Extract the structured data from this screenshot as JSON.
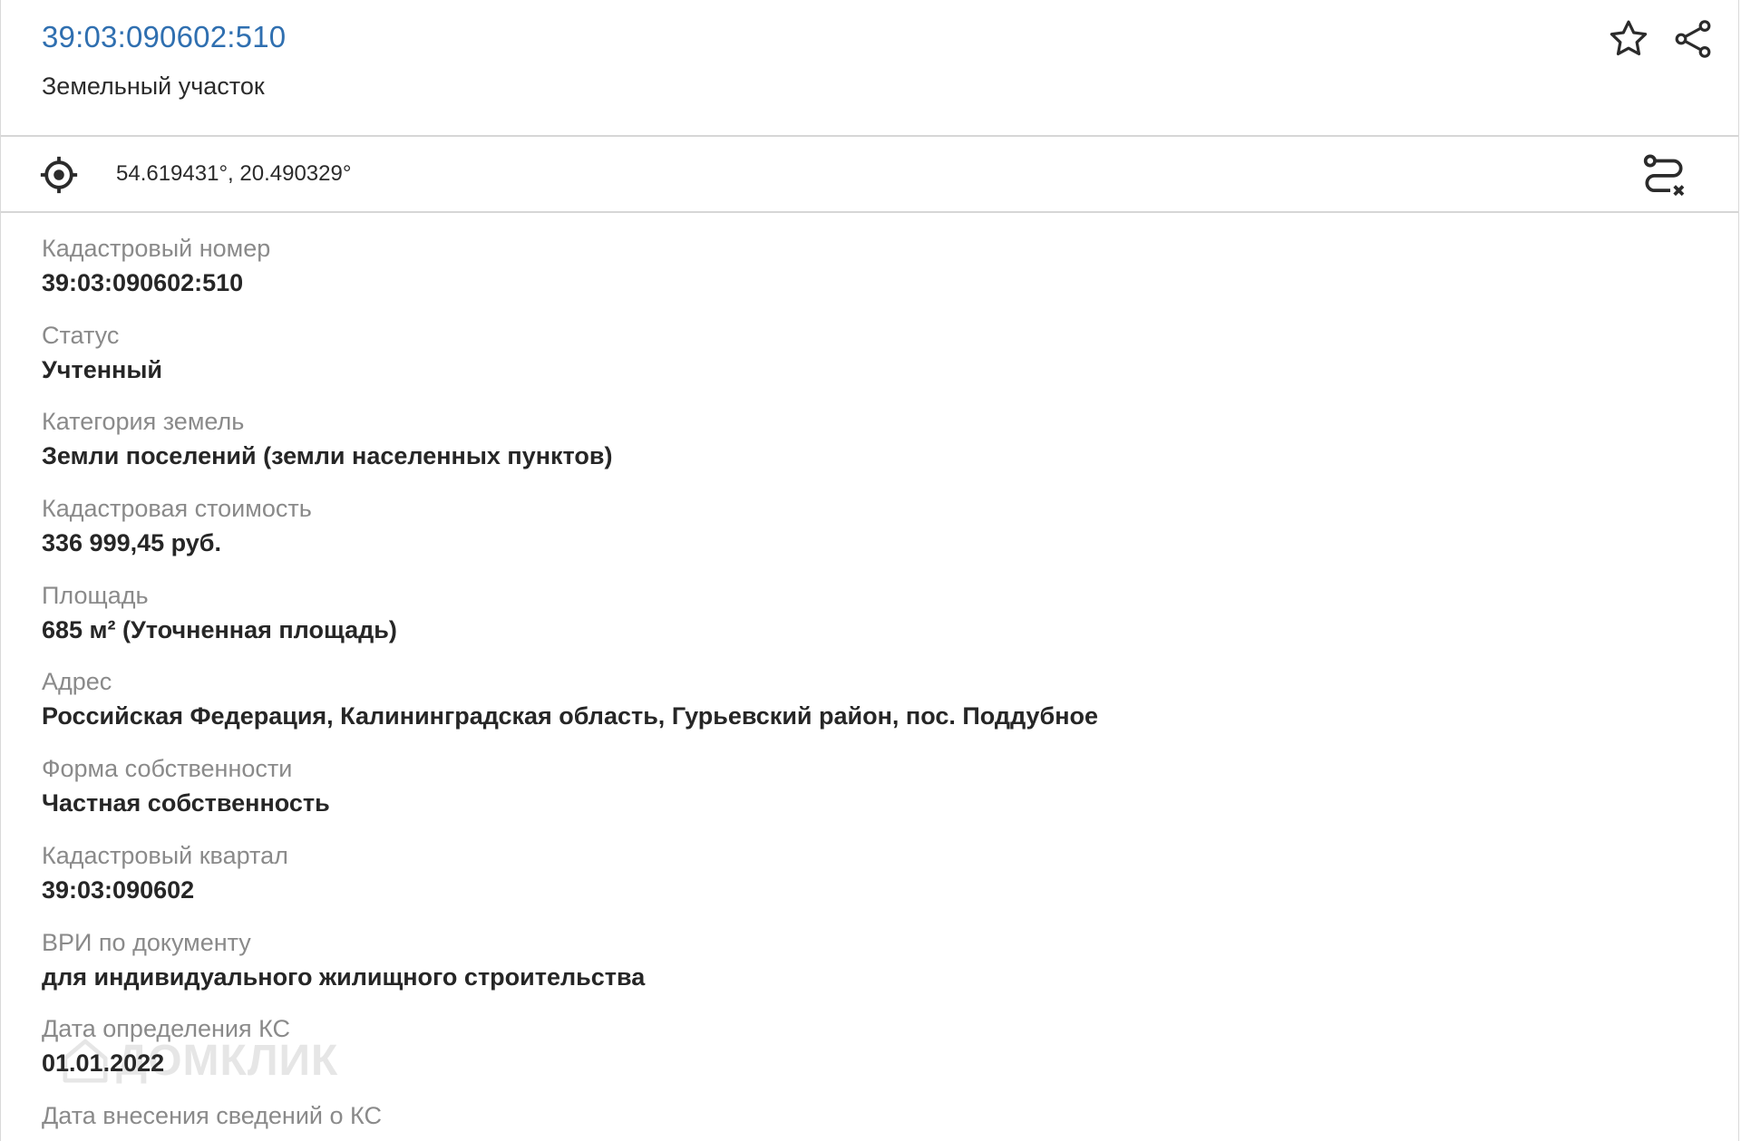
{
  "header": {
    "cadastral_link": "39:03:090602:510",
    "subtitle": "Земельный участок",
    "icons": [
      "star-icon",
      "share-icon"
    ]
  },
  "coords": {
    "text": "54.619431°, 20.490329°",
    "icons": [
      "target-icon",
      "route-icon"
    ]
  },
  "fields": [
    {
      "label": "Кадастровый номер",
      "value": "39:03:090602:510"
    },
    {
      "label": "Статус",
      "value": "Учтенный"
    },
    {
      "label": "Категория земель",
      "value": "Земли поселений (земли населенных пунктов)"
    },
    {
      "label": "Кадастровая стоимость",
      "value": "336 999,45 руб."
    },
    {
      "label": "Площадь",
      "value": "685 м² (Уточненная площадь)"
    },
    {
      "label": "Адрес",
      "value": "Российская Федерация, Калининградская область, Гурьевский район, пос. Поддубное"
    },
    {
      "label": "Форма собственности",
      "value": "Частная собственность"
    },
    {
      "label": "Кадастровый квартал",
      "value": "39:03:090602"
    },
    {
      "label": "ВРИ по документу",
      "value": "для индивидуального жилищного строительства"
    },
    {
      "label": "Дата определения КС",
      "value": "01.01.2022"
    },
    {
      "label": "Дата внесения сведений о КС",
      "value": ""
    }
  ],
  "watermark": {
    "text": "ДОМКЛИК",
    "icon": "house-logo-icon"
  },
  "colors": {
    "link": "#2f6fb0",
    "label": "#8a8a8a",
    "value": "#262626",
    "divider": "#d6d6d6"
  }
}
